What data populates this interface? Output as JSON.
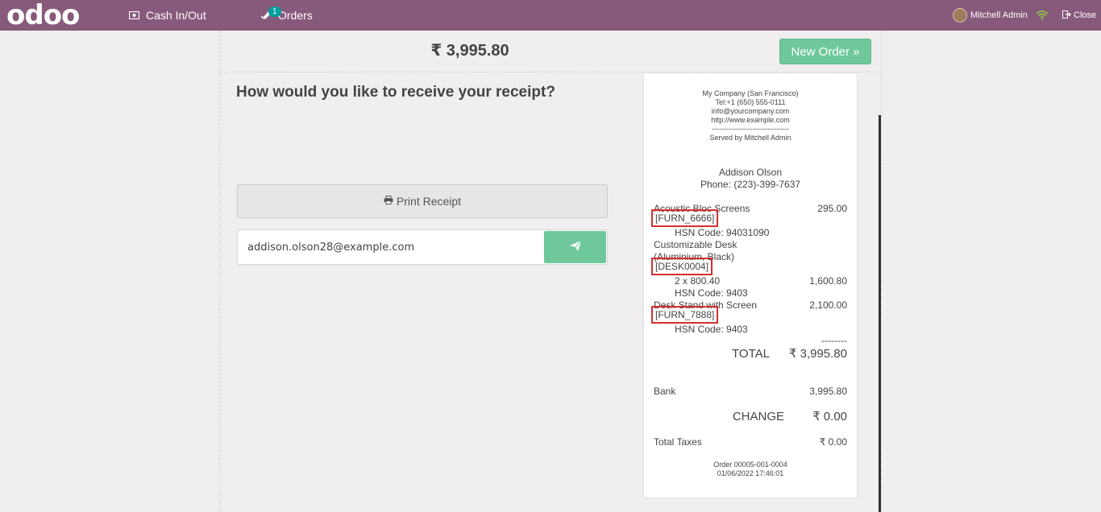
{
  "navbar": {
    "logo": "odoo",
    "cash_label": "Cash In/Out",
    "orders_label": "Orders",
    "orders_badge": "1",
    "user_name": "Mitchell Admin",
    "close_label": "Close"
  },
  "order": {
    "total": "₹ 3,995.80",
    "new_order_label": "New Order »"
  },
  "receipt_screen": {
    "question": "How would you like to receive your receipt?",
    "print_label": "Print Receipt",
    "email_value": "addison.olson28@example.com"
  },
  "receipt": {
    "company": "My Company (San Francisco)",
    "tel": "Tel:+1 (650) 555-0111",
    "email": "info@yourcompany.com",
    "website": "http://www.example.com",
    "separator": "--------------------------------",
    "served_by": "Served by Mitchell Admin",
    "customer_name": "Addison Olson",
    "customer_phone": "Phone: (223)-399-7637",
    "lines": [
      {
        "name": "Acoustic Bloc Screens",
        "code": "[FURN_6666]",
        "hsn": "HSN Code: 94031090",
        "amount": "295.00"
      },
      {
        "name": "Customizable Desk",
        "name2": "(Aluminium, Black)",
        "code": "[DESK0004]",
        "qty": "2 x 800.40",
        "hsn": "HSN Code: 9403",
        "amount": "1,600.80"
      },
      {
        "name": "Desk Stand with Screen",
        "code": "[FURN_7888]",
        "hsn": "HSN Code: 9403",
        "amount": "2,100.00"
      }
    ],
    "dashes": "--------",
    "total_label": "TOTAL",
    "total_value": "₹ 3,995.80",
    "payment_label": "Bank",
    "payment_value": "3,995.80",
    "change_label": "CHANGE",
    "change_value": "₹ 0.00",
    "taxes_label": "Total Taxes",
    "taxes_value": "₹ 0.00",
    "order_ref": "Order 00005-001-0004",
    "order_date": "01/06/2022 17:46:01"
  }
}
